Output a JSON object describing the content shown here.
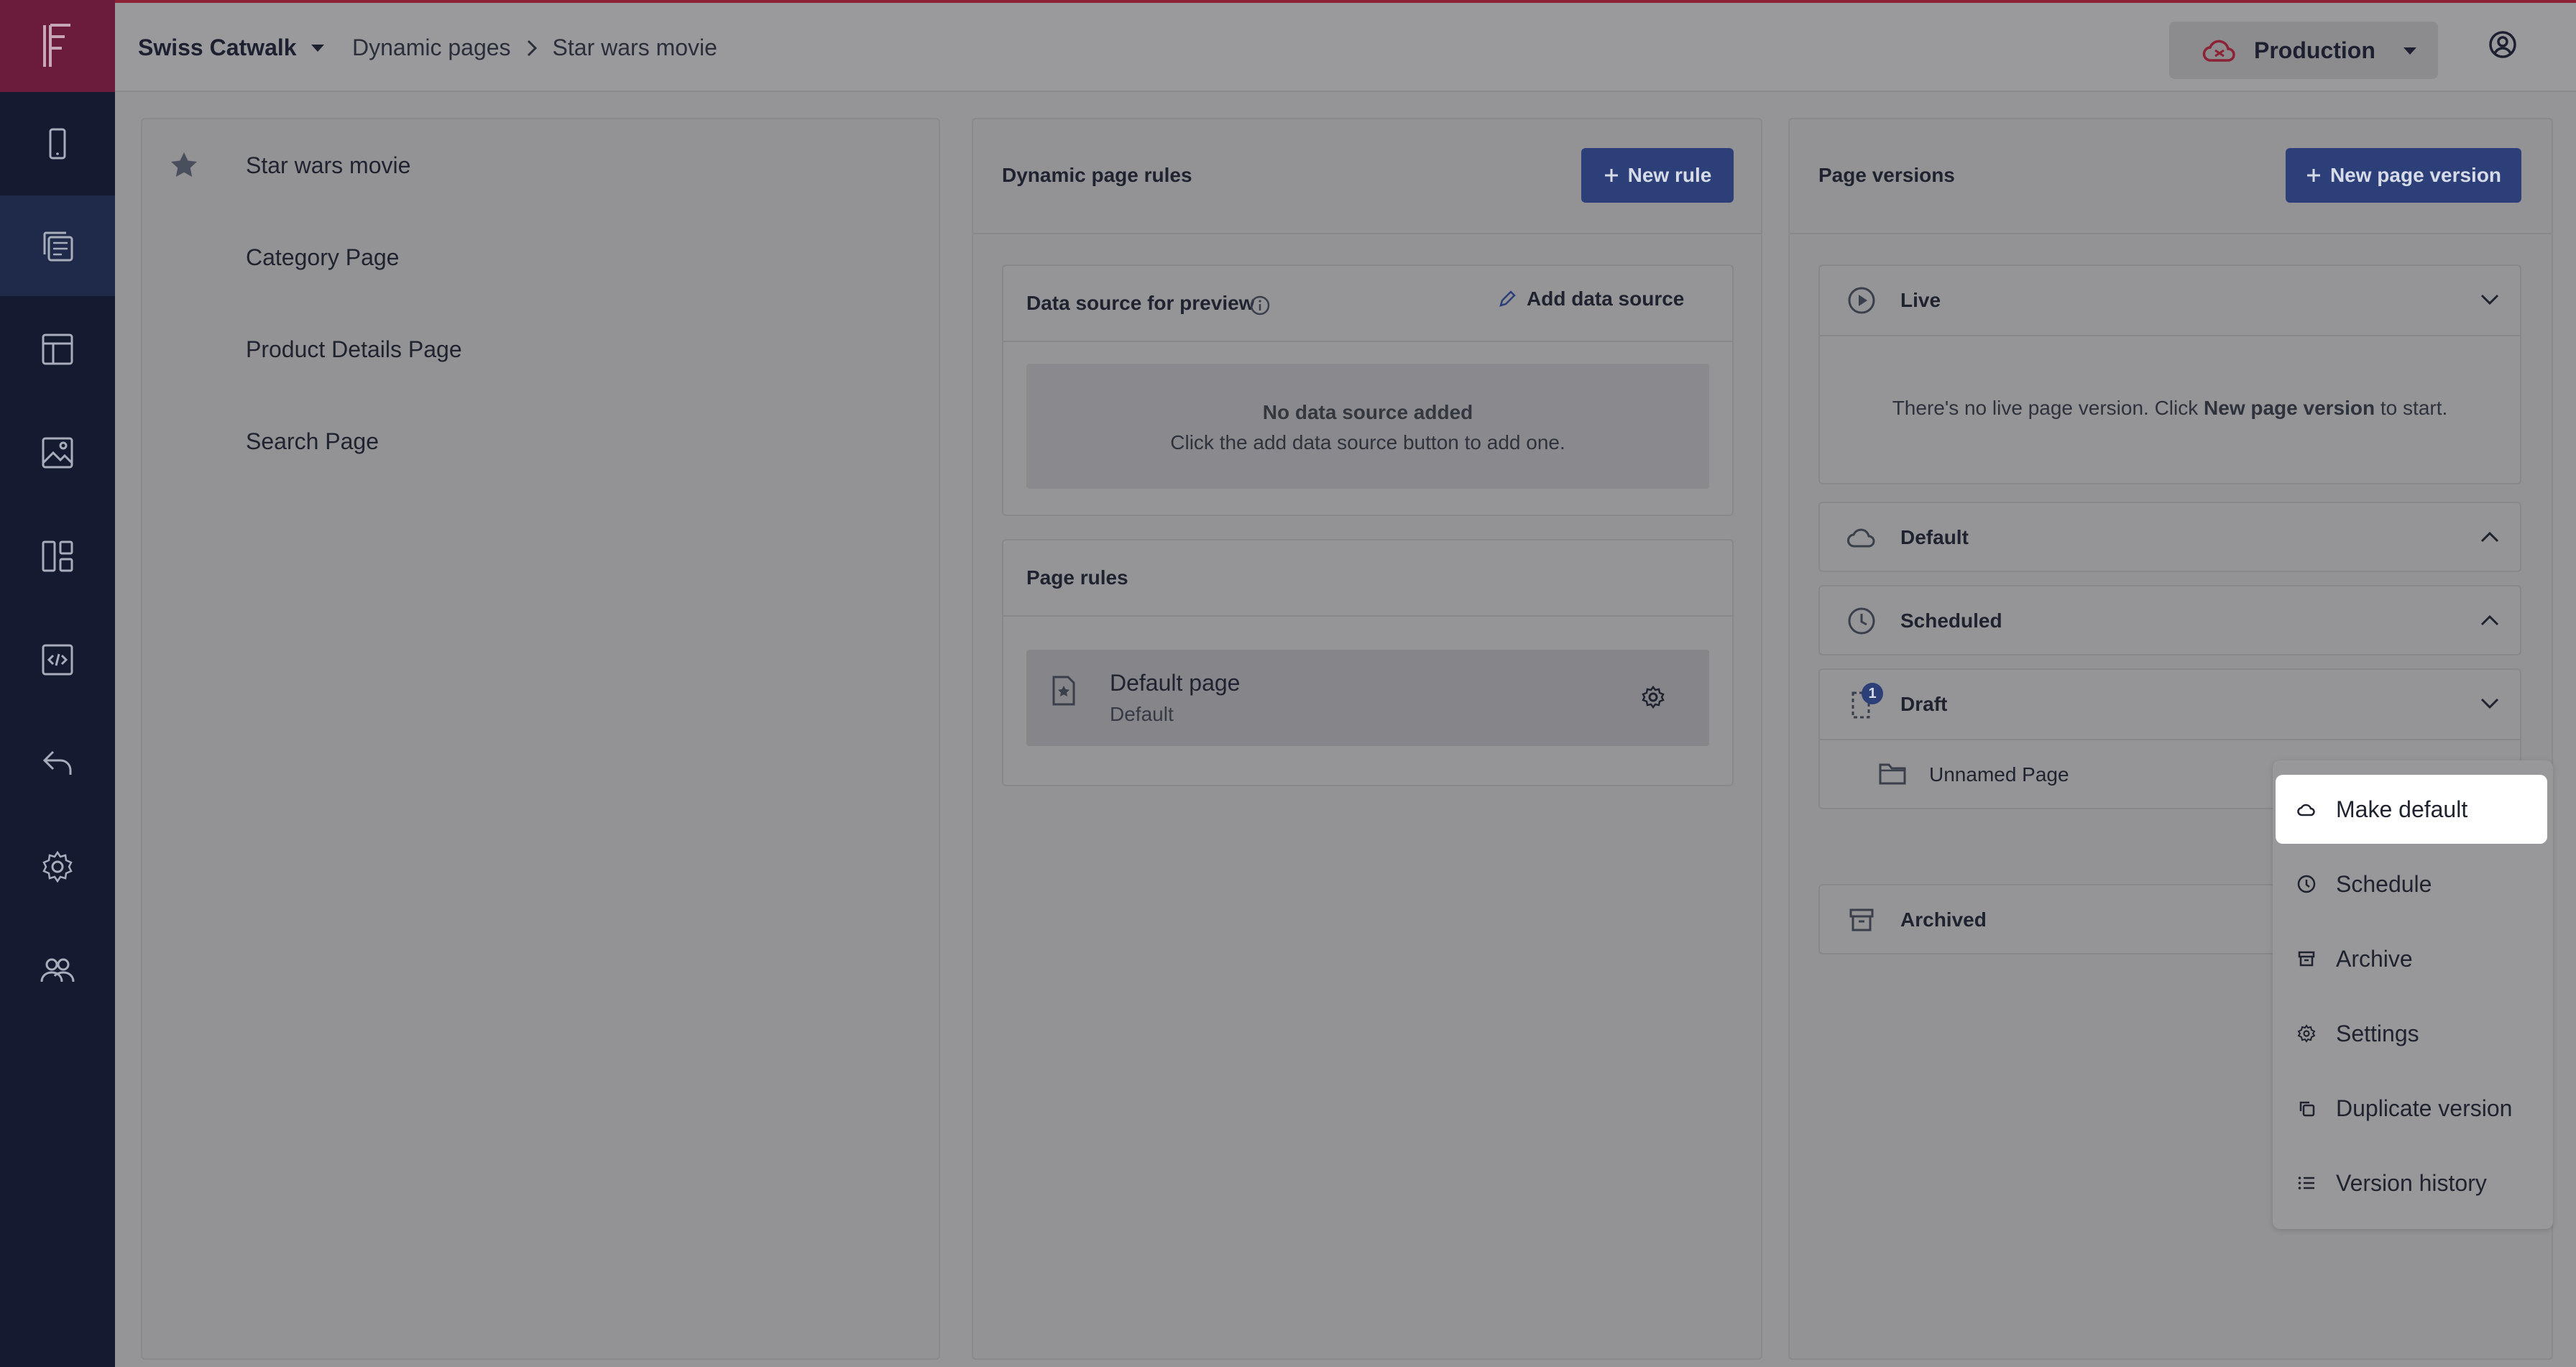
{
  "sidebar": {
    "logo_icon": "f-logo-icon",
    "items": [
      {
        "icon": "mobile-icon",
        "active": false
      },
      {
        "icon": "pages-icon",
        "active": true
      },
      {
        "icon": "layout-icon",
        "active": false
      },
      {
        "icon": "image-icon",
        "active": false
      },
      {
        "icon": "components-icon",
        "active": false
      },
      {
        "icon": "code-icon",
        "active": false
      },
      {
        "icon": "undo-icon",
        "active": false
      },
      {
        "icon": "settings-icon",
        "active": false
      },
      {
        "icon": "users-icon",
        "active": false
      }
    ]
  },
  "header": {
    "project": "Swiss Catwalk",
    "breadcrumb": [
      "Dynamic pages",
      "Star wars movie"
    ],
    "environment": "Production",
    "accent_color": "#8d2236"
  },
  "pages": {
    "items": [
      {
        "label": "Star wars movie",
        "starred": true
      },
      {
        "label": "Category Page",
        "starred": false
      },
      {
        "label": "Product Details Page",
        "starred": false
      },
      {
        "label": "Search Page",
        "starred": false
      }
    ]
  },
  "rules": {
    "title": "Dynamic page rules",
    "new_rule_label": "New rule",
    "data_source": {
      "title": "Data source for preview",
      "add_label": "Add data source",
      "empty_title": "No data source added",
      "empty_text": "Click the add data source button to add one."
    },
    "page_rules": {
      "title": "Page rules",
      "item_title": "Default page",
      "item_subtitle": "Default"
    }
  },
  "versions": {
    "title": "Page versions",
    "new_version_label": "New page version",
    "live": {
      "label": "Live",
      "empty_prefix": "There's no live page version. Click ",
      "empty_bold": "New page version",
      "empty_suffix": " to start."
    },
    "default_label": "Default",
    "scheduled_label": "Scheduled",
    "draft": {
      "label": "Draft",
      "badge": "1",
      "item": "Unnamed Page"
    },
    "archived_label": "Archived"
  },
  "menu": {
    "items": [
      {
        "label": "Make default",
        "icon": "cloud-icon"
      },
      {
        "label": "Schedule",
        "icon": "clock-icon"
      },
      {
        "label": "Archive",
        "icon": "archive-icon"
      },
      {
        "label": "Settings",
        "icon": "gear-icon"
      },
      {
        "label": "Duplicate version",
        "icon": "duplicate-icon"
      },
      {
        "label": "Version history",
        "icon": "list-icon"
      }
    ]
  }
}
